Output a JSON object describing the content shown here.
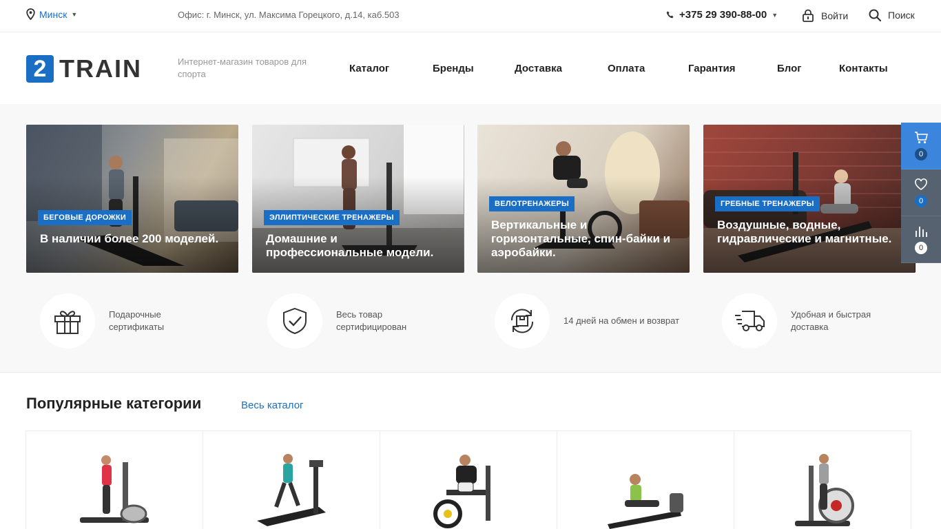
{
  "topbar": {
    "city": "Минск",
    "office": "Офис: г. Минск, ул. Максима Горецкого, д.14, каб.503",
    "phone": "+375 29 390-88-00",
    "login": "Войти",
    "search": "Поиск"
  },
  "header": {
    "logo_mark": "2",
    "logo_word": "TRAIN",
    "tagline": "Интернет-магазин товаров для спорта",
    "nav": [
      "Каталог",
      "Бренды",
      "Доставка",
      "Оплата",
      "Гарантия",
      "Блог",
      "Контакты"
    ]
  },
  "banners": [
    {
      "badge": "БЕГОВЫЕ ДОРОЖКИ",
      "text": "В наличии более 200 моделей."
    },
    {
      "badge": "ЭЛЛИПТИЧЕСКИЕ ТРЕНАЖЕРЫ",
      "text": "Домашние и профессиональные модели."
    },
    {
      "badge": "ВЕЛОТРЕНАЖЕРЫ",
      "text": "Вертикальные и горизонтальные, спин-байки и аэробайки."
    },
    {
      "badge": "ГРЕБНЫЕ ТРЕНАЖЕРЫ",
      "text": "Воздушные, водные, гидравлические и магнитные."
    }
  ],
  "advantages": [
    {
      "icon": "gift-icon",
      "text": "Подарочные сертификаты"
    },
    {
      "icon": "shield-check-icon",
      "text": "Весь товар сертифицирован"
    },
    {
      "icon": "exchange-box-icon",
      "text": "14 дней на обмен и возврат"
    },
    {
      "icon": "delivery-truck-icon",
      "text": "Удобная и быстрая доставка"
    }
  ],
  "side_panel": {
    "cart": "0",
    "favorites": "0",
    "compare": "0"
  },
  "popular": {
    "title": "Популярные категории",
    "all_link": "Весь каталог"
  },
  "colors": {
    "accent": "#1a6fc4",
    "panel_active": "#3b86dc",
    "panel_dark": "#56626f"
  }
}
